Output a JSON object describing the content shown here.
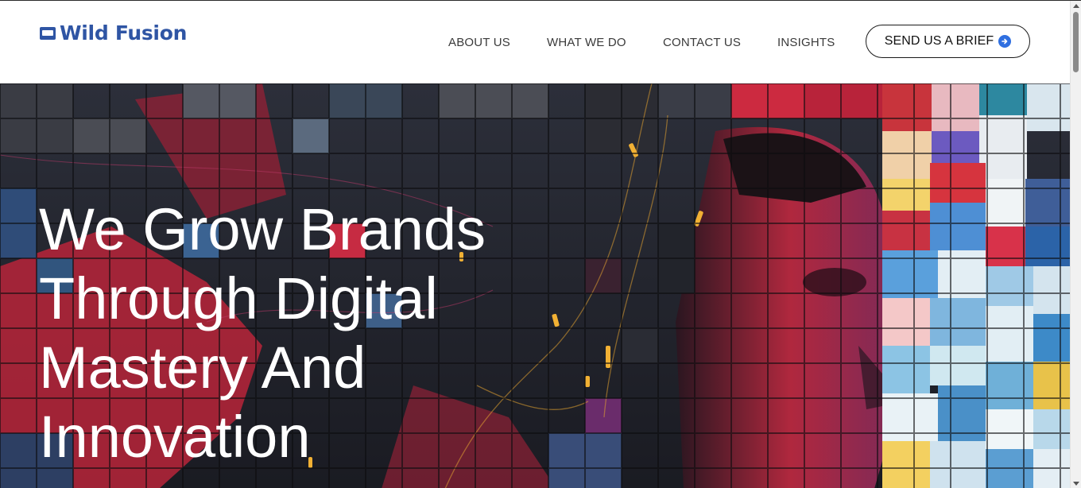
{
  "brand": {
    "name": "Wild Fusion",
    "accent_color": "#2f55a4",
    "logo_icon": "browser-window-icon"
  },
  "nav": {
    "items": [
      {
        "label": "ABOUT US"
      },
      {
        "label": "WHAT WE DO"
      },
      {
        "label": "CONTACT US"
      },
      {
        "label": "INSIGHTS"
      }
    ],
    "cta": {
      "label": "SEND US A BRIEF",
      "icon": "arrow-right-circle-icon",
      "icon_color": "#2f6fe0"
    }
  },
  "hero": {
    "title": "We Grow Brands Through Digital Mastery And Innovation",
    "background": "mosaic-portrait-image",
    "title_color": "#ffffff"
  },
  "colors": {
    "header_bg": "#ffffff",
    "nav_text": "#3a3a3a",
    "mosaic_red": "#c8283c",
    "mosaic_dark": "#1d1d22",
    "mosaic_blue": "#3c6fb0"
  }
}
